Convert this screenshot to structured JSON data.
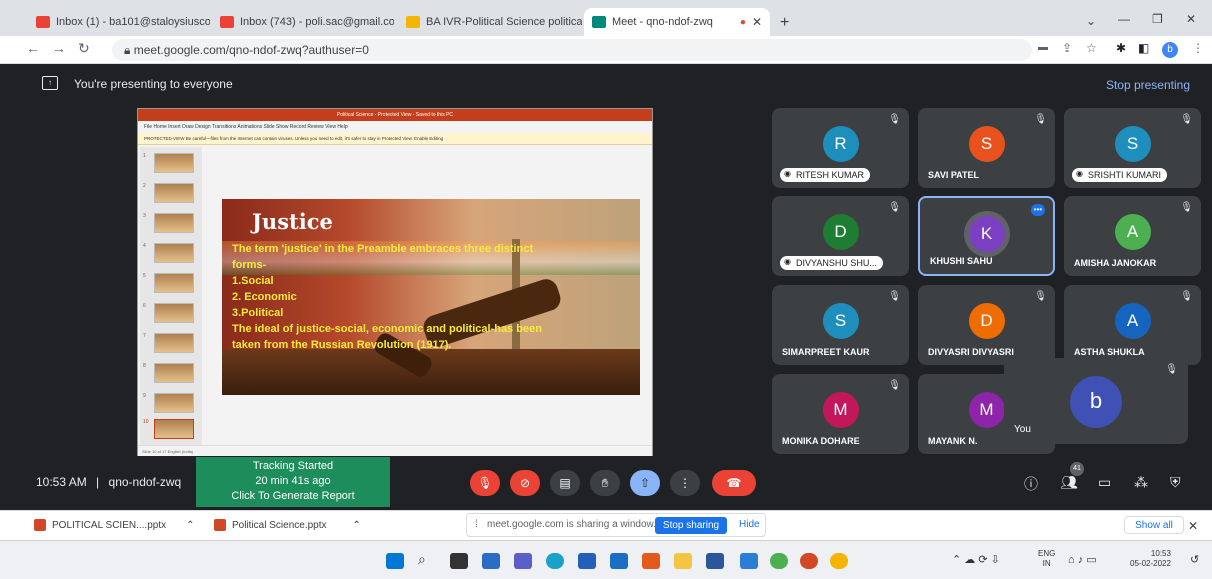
{
  "browser": {
    "tabs": [
      {
        "label": "Inbox (1) - ba101@staloysiuscoll",
        "color": "#ea4335"
      },
      {
        "label": "Inbox (743) - poli.sac@gmail.com",
        "color": "#ea4335"
      },
      {
        "label": "BA IVR-Political Science political",
        "color": "#f4b400"
      },
      {
        "label": "Meet - qno-ndof-zwq",
        "color": "#00897b"
      }
    ],
    "new_tab": "+",
    "url": "meet.google.com/qno-ndof-zwq?authuser=0",
    "profile": "b"
  },
  "meet": {
    "presenting_text": "You're presenting to everyone",
    "stop_presenting": "Stop presenting",
    "time": "10:53 AM",
    "separator": "|",
    "meeting_code": "qno-ndof-zwq",
    "participant_count": "41",
    "tracking": {
      "line1": "Tracking Started",
      "line2": "20 min 41s ago",
      "line3": "Click To Generate Report"
    },
    "participants": [
      {
        "initial": "R",
        "name": "RITESH KUMAR",
        "color": "#1e8fbd",
        "pill": true
      },
      {
        "initial": "S",
        "name": "SAVI PATEL",
        "color": "#e8521e",
        "pill": false
      },
      {
        "initial": "S",
        "name": "SRISHTI KUMARI",
        "color": "#1e8fbd",
        "pill": true
      },
      {
        "initial": "D",
        "name": "DIVYANSHU SHU...",
        "color": "#1e7d32",
        "pill": true
      },
      {
        "initial": "K",
        "name": "KHUSHI SAHU",
        "color": "#7b3fc1",
        "pill": false
      },
      {
        "initial": "A",
        "name": "AMISHA JANOKAR",
        "color": "#4caf50",
        "pill": false
      },
      {
        "initial": "S",
        "name": "SIMARPREET KAUR",
        "color": "#1e8fbd",
        "pill": false
      },
      {
        "initial": "D",
        "name": "DIVYASRI DIVYASRI",
        "color": "#ef6c00",
        "pill": false
      },
      {
        "initial": "A",
        "name": "ASTHA SHUKLA",
        "color": "#1565c0",
        "pill": false
      },
      {
        "initial": "M",
        "name": "MONIKA DOHARE",
        "color": "#c2185b",
        "pill": false
      },
      {
        "initial": "M",
        "name": "MAYANK N.",
        "color": "#8e24aa",
        "pill": false
      }
    ],
    "self": {
      "initial": "b",
      "label": "You",
      "color": "#3f51b5"
    }
  },
  "slide": {
    "window_title": "Political Science - Protected View - Saved to this PC",
    "menu": "File    Home    Insert    Draw    Design    Transitions    Animations    Slide Show    Record    Review    View    Help",
    "protected_view": "PROTECTED VIEW  Be careful—files from the Internet can contain viruses. Unless you need to edit, it's safer to stay in Protected View.   Enable Editing",
    "status": "Slide 10 of 17      English (India)",
    "title": "Justice",
    "lines": [
      "The term 'justice' in the Preamble embraces three distinct",
      "forms-",
      "1.Social",
      "2. Economic",
      "3.Political",
      "The ideal of justice-social, economic and political-has been",
      "taken from the Russian Revolution (1917)."
    ]
  },
  "downloads": {
    "items": [
      "POLITICAL SCIEN....pptx",
      "Political Science.pptx"
    ],
    "sharing_text": "meet.google.com is sharing a window.",
    "stop_sharing": "Stop sharing",
    "hide": "Hide",
    "show_all": "Show all"
  },
  "taskbar": {
    "lang1": "ENG",
    "lang2": "IN",
    "time": "10:53",
    "date": "05-02-2022"
  }
}
